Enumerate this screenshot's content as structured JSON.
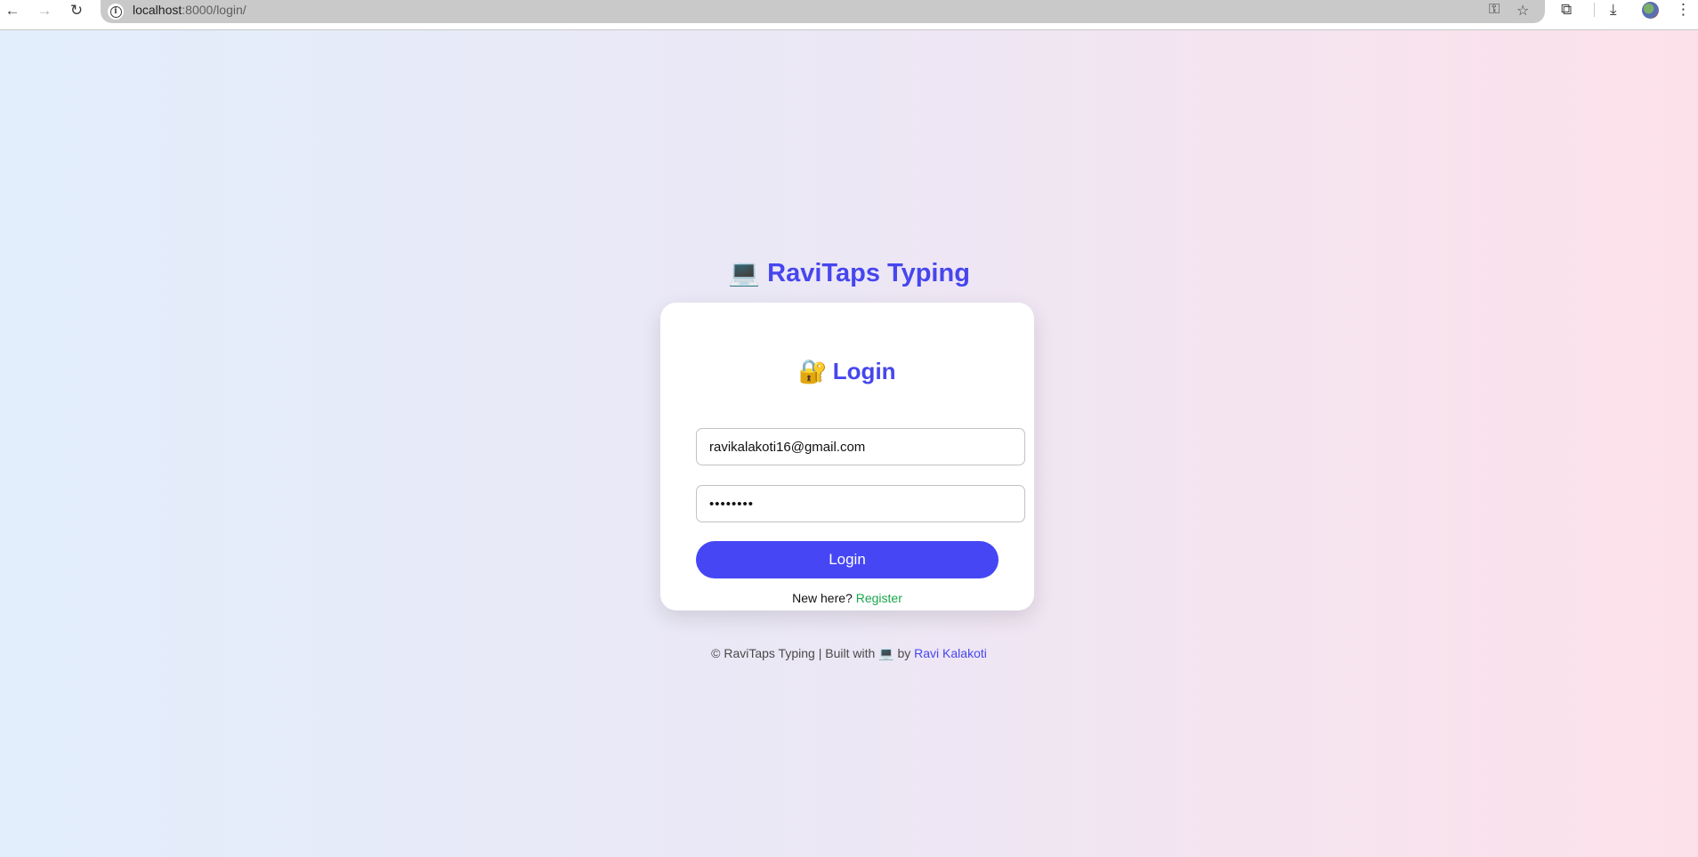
{
  "browser": {
    "url_host": "localhost",
    "url_path": ":8000/login/",
    "icons": {
      "back": "←",
      "forward": "→",
      "reload": "↻",
      "key": "⚿",
      "star": "☆",
      "extensions": "⧉",
      "download": "⤓",
      "menu": "⋮"
    }
  },
  "header": {
    "emoji": "💻",
    "title": "RaviTaps Typing"
  },
  "login_card": {
    "emoji": "🔐",
    "title": "Login",
    "email_value": "ravikalakoti16@gmail.com",
    "password_value": "••••••••",
    "button_label": "Login",
    "prompt_text": "New here?",
    "register_link": "Register"
  },
  "footer": {
    "prefix": "© RaviTaps Typing | Built with",
    "emoji": "💻",
    "by": "by",
    "author_link": "Ravi Kalakoti"
  },
  "colors": {
    "accent": "#4646ee",
    "button": "#4646f5",
    "register_link": "#19a64a"
  }
}
